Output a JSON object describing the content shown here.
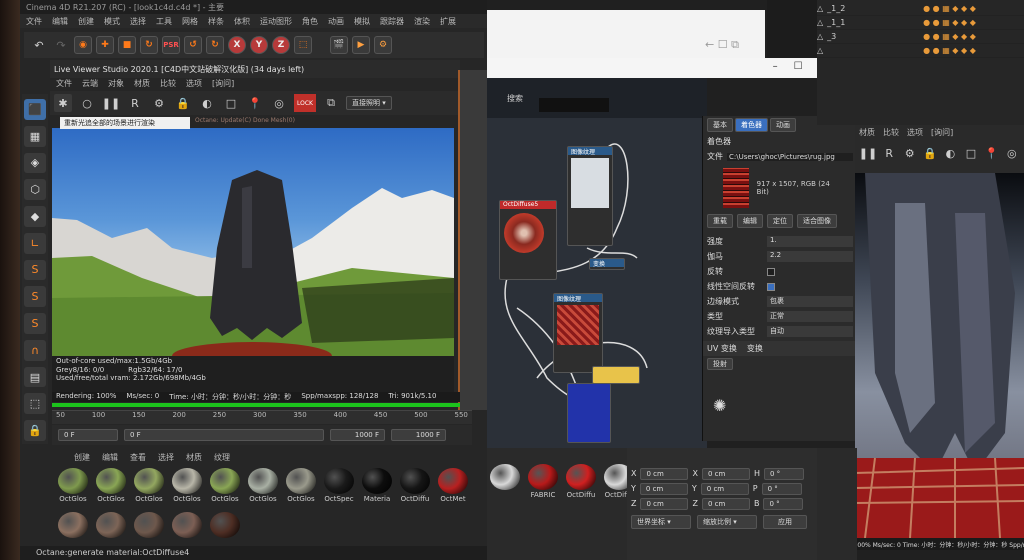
{
  "left": {
    "title": "Cinema 4D R21.207 (RC) - [look1c4d.c4d *] - 主要",
    "menu": [
      "文件",
      "编辑",
      "创建",
      "模式",
      "选择",
      "工具",
      "网格",
      "样条",
      "体积",
      "运动图形",
      "角色",
      "动画",
      "模拟",
      "跟踪器",
      "渲染",
      "扩展"
    ],
    "toolbar_axes": [
      "X",
      "Y",
      "Z"
    ],
    "live_viewer": {
      "title": "Live Viewer Studio 2020.1 [C4D中文站破解汉化版] (34 days left)",
      "menu": [
        "文件",
        "云端",
        "对象",
        "材质",
        "比较",
        "选项",
        "[询问]"
      ],
      "mode": "直接照明",
      "tooltip": "重新光追全部的场景进行渲染",
      "status_line": "Octane: Update(C) Done  Mesh(0)",
      "stats": {
        "outofcore": "Out-of-core used/max:1.5Gb/4Gb",
        "grey": "Grey8/16: 0/0",
        "rgb": "Rgb32/64: 17/0",
        "vram": "Used/free/total vram: 2.172Gb/698Mb/4Gb",
        "rendering": "Rendering: 100%",
        "mssec": "Ms/sec: 0",
        "time": "Time: 小时：分钟：秒/小时：分钟：秒",
        "spp": "Spp/maxspp: 128/128",
        "tri": "Tri: 901k/5.10"
      }
    },
    "timeline": {
      "ticks": [
        "50",
        "100",
        "150",
        "200",
        "250",
        "300",
        "350",
        "400",
        "450",
        "500",
        "550"
      ],
      "frame_start": "0 F",
      "frame_cur": "0 F",
      "frame_end": "1000 F",
      "frame_end2": "1000 F"
    },
    "material_menu": [
      "创建",
      "编辑",
      "查看",
      "选择",
      "材质",
      "纹理"
    ],
    "materials_row1": [
      {
        "label": "OctGlos",
        "color": "#7f9a4e"
      },
      {
        "label": "OctGlos",
        "color": "#8aa655"
      },
      {
        "label": "OctGlos",
        "color": "#93a760"
      },
      {
        "label": "OctGlos",
        "color": "#b8b6a8"
      },
      {
        "label": "OctGlos",
        "color": "#8aa655"
      },
      {
        "label": "OctGlos",
        "color": "#a9b0a4"
      },
      {
        "label": "OctGlos",
        "color": "#9a9a8c"
      },
      {
        "label": "OctSpec",
        "color": "#1a1a1a"
      },
      {
        "label": "Materia",
        "color": "#0d0d0d"
      },
      {
        "label": "OctDiffu",
        "color": "#151515"
      },
      {
        "label": "OctMet",
        "color": "#b82020"
      }
    ],
    "materials_row2": [
      {
        "label": "",
        "color": "#8b7060"
      },
      {
        "label": "",
        "color": "#7d6557"
      },
      {
        "label": "",
        "color": "#6e584c"
      },
      {
        "label": "",
        "color": "#7c5f54"
      },
      {
        "label": "",
        "color": "#4e2e24"
      }
    ],
    "statusbar": "Octane:generate material:OctDiffuse4"
  },
  "right": {
    "tabs": [
      "基本",
      "着色器",
      "动画"
    ],
    "active_tab": "着色器",
    "section": "着色器",
    "file_label": "文件",
    "file_path": "C:\\Users\\ghoc\\Pictures\\rug.jpg",
    "image_info": "917 x 1507, RGB (24 Bit)",
    "buttons": [
      "重载",
      "编辑",
      "定位",
      "适合图像"
    ],
    "props": [
      {
        "label": "强度",
        "value": "1."
      },
      {
        "label": "伽马",
        "value": "2.2"
      },
      {
        "label": "反转",
        "value": ""
      },
      {
        "label": "线性空间反转",
        "value": ""
      },
      {
        "label": "边缘模式",
        "value": "包裹"
      },
      {
        "label": "类型",
        "value": "正常"
      },
      {
        "label": "纹理导入类型",
        "value": "自动"
      }
    ],
    "uv_label": "UV 变换",
    "uv_value": "变换",
    "projection": "投射",
    "search": "搜索",
    "node_names": {
      "n1": "图像纹理",
      "n2": "OctDiffuse5",
      "n3": "图像纹理",
      "n4": "变换"
    },
    "coords": [
      {
        "axis": "X",
        "pos": "0 cm",
        "size": "0 cm",
        "rot_label": "H",
        "rot": "0 °"
      },
      {
        "axis": "Y",
        "pos": "0 cm",
        "size": "0 cm",
        "rot_label": "P",
        "rot": "0 °"
      },
      {
        "axis": "Z",
        "pos": "0 cm",
        "size": "0 cm",
        "rot_label": "B",
        "rot": "0 °"
      }
    ],
    "coord_mode": "世界坐标",
    "scale_mode": "缩放比例",
    "apply": "应用",
    "lower_materials": [
      {
        "label": "",
        "color": "#d8d8d8"
      },
      {
        "label": "FABRIC",
        "color": "#b81a1a"
      },
      {
        "label": "OctDiffu",
        "color": "#d02020"
      },
      {
        "label": "OctDiffu",
        "color": "#d8d8d8"
      },
      {
        "label": "Materia",
        "color": "#c01818"
      }
    ],
    "objects": [
      "_1_2",
      "_1_1",
      "_3",
      ""
    ],
    "viewer_menu": [
      "材质",
      "比较",
      "选项",
      "[询问]"
    ],
    "viewer_stats": "Rendering: 100%  Ms/sec: 0  Time: 小时：分钟：秒/小时：分钟：秒  Spp/maxspp"
  }
}
